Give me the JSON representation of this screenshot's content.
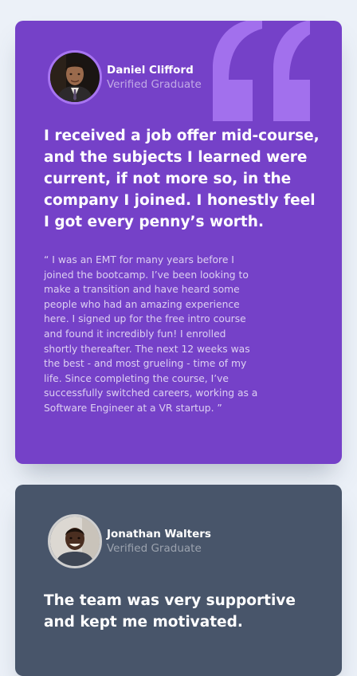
{
  "colors": {
    "page_background": "#ecf1f8",
    "card_purple": "#7541c8",
    "card_dark_blue": "#48556a",
    "quote_mark": "#a775f1"
  },
  "testimonials": [
    {
      "name": "Daniel Clifford",
      "role": "Verified Graduate",
      "headline": "I received a job offer mid-course, and the subjects I learned were current, if not more so, in the company I joined. I honestly feel I got every penny’s worth.",
      "quote": "“ I was an EMT for many years before I joined the bootcamp. I’ve been looking to make a transition and have heard some people who had an amazing experience here. I signed up for the free intro course and found it incredibly fun! I enrolled shortly thereafter. The next 12 weeks was the best - and most grueling - time of my life. Since completing the course, I’ve successfully switched careers, working as a Software Engineer at a VR startup. ”"
    },
    {
      "name": "Jonathan Walters",
      "role": "Verified Graduate",
      "headline": "The team was very supportive and kept me motivated."
    }
  ]
}
